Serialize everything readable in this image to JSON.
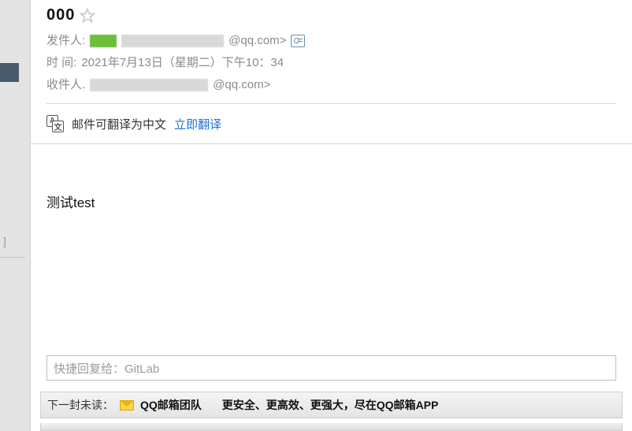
{
  "left": {
    "bracket_hint": "]"
  },
  "mail": {
    "subject": "000",
    "from_label": "发件人:",
    "from_suffix": "@qq.com>",
    "date_label": "时   间:",
    "date_value": "2021年7月13日（星期二）下午10：34",
    "to_label": "收件人.",
    "to_suffix": "@qq.com>"
  },
  "translate": {
    "text": "邮件可翻译为中文",
    "link": "立即翻译"
  },
  "body": {
    "content": "测试test"
  },
  "reply": {
    "placeholder": "快捷回复给：GitLab"
  },
  "next": {
    "label": "下一封未读：",
    "sender": "QQ邮箱团队",
    "title": "更安全、更高效、更强大，尽在QQ邮箱APP"
  }
}
